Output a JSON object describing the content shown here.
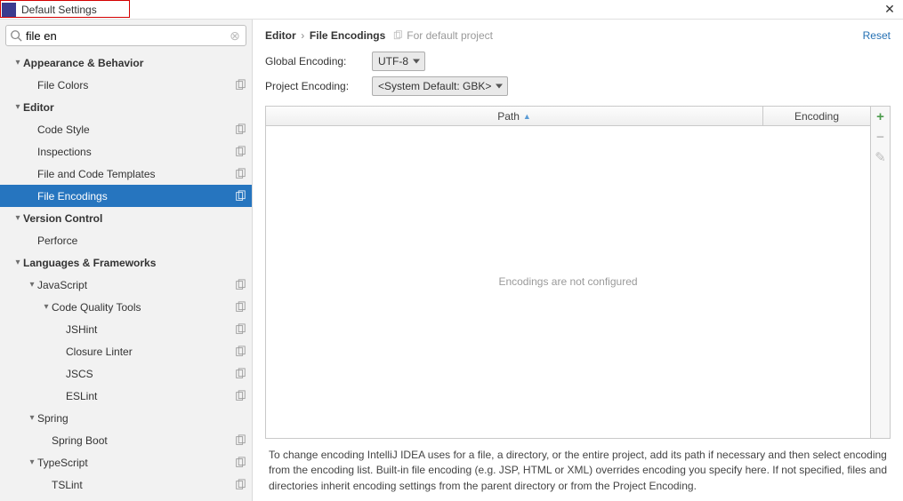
{
  "window": {
    "title": "Default Settings"
  },
  "search": {
    "value": "file en"
  },
  "header": {
    "crumb_parent": "Editor",
    "crumb_child": "File Encodings",
    "subnote": "For default project",
    "reset": "Reset"
  },
  "form": {
    "global_label": "Global Encoding:",
    "global_value": "UTF-8",
    "project_label": "Project Encoding:",
    "project_value": "<System Default: GBK>"
  },
  "table": {
    "col_path": "Path",
    "col_encoding": "Encoding",
    "empty": "Encodings are not configured"
  },
  "help": "To change encoding IntelliJ IDEA uses for a file, a directory, or the entire project, add its path if necessary and then select encoding from the encoding list. Built-in file encoding (e.g. JSP, HTML or XML) overrides encoding you specify here. If not specified, files and directories inherit encoding settings from the parent directory or from the Project Encoding.",
  "tree": [
    {
      "label": "Appearance & Behavior",
      "indent": 0,
      "bold": true,
      "arrow": "down",
      "copy": false
    },
    {
      "label": "File Colors",
      "indent": 1,
      "bold": false,
      "arrow": "",
      "copy": true
    },
    {
      "label": "Editor",
      "indent": 0,
      "bold": true,
      "arrow": "down",
      "copy": false
    },
    {
      "label": "Code Style",
      "indent": 1,
      "bold": false,
      "arrow": "",
      "copy": true
    },
    {
      "label": "Inspections",
      "indent": 1,
      "bold": false,
      "arrow": "",
      "copy": true
    },
    {
      "label": "File and Code Templates",
      "indent": 1,
      "bold": false,
      "arrow": "",
      "copy": true
    },
    {
      "label": "File Encodings",
      "indent": 1,
      "bold": false,
      "arrow": "",
      "copy": true,
      "selected": true
    },
    {
      "label": "Version Control",
      "indent": 0,
      "bold": true,
      "arrow": "down",
      "copy": false
    },
    {
      "label": "Perforce",
      "indent": 1,
      "bold": false,
      "arrow": "",
      "copy": false
    },
    {
      "label": "Languages & Frameworks",
      "indent": 0,
      "bold": true,
      "arrow": "down",
      "copy": false
    },
    {
      "label": "JavaScript",
      "indent": 1,
      "bold": false,
      "arrow": "down",
      "copy": true
    },
    {
      "label": "Code Quality Tools",
      "indent": 2,
      "bold": false,
      "arrow": "down",
      "copy": true
    },
    {
      "label": "JSHint",
      "indent": 3,
      "bold": false,
      "arrow": "",
      "copy": true
    },
    {
      "label": "Closure Linter",
      "indent": 3,
      "bold": false,
      "arrow": "",
      "copy": true
    },
    {
      "label": "JSCS",
      "indent": 3,
      "bold": false,
      "arrow": "",
      "copy": true
    },
    {
      "label": "ESLint",
      "indent": 3,
      "bold": false,
      "arrow": "",
      "copy": true
    },
    {
      "label": "Spring",
      "indent": 1,
      "bold": false,
      "arrow": "down",
      "copy": false
    },
    {
      "label": "Spring Boot",
      "indent": 2,
      "bold": false,
      "arrow": "",
      "copy": true
    },
    {
      "label": "TypeScript",
      "indent": 1,
      "bold": false,
      "arrow": "down",
      "copy": true
    },
    {
      "label": "TSLint",
      "indent": 2,
      "bold": false,
      "arrow": "",
      "copy": true
    }
  ]
}
